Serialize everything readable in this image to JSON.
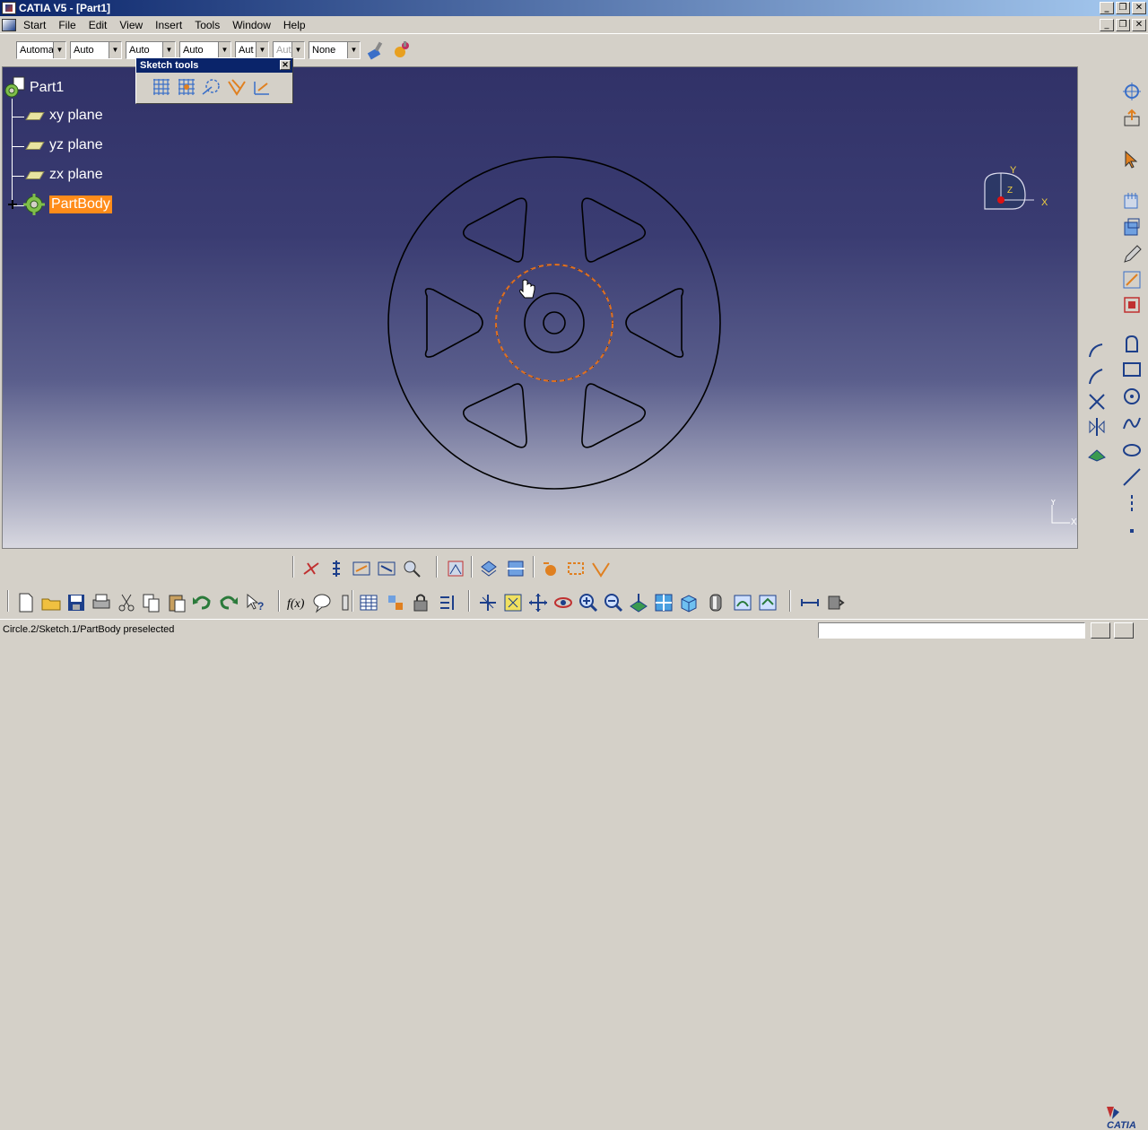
{
  "window": {
    "title": "CATIA V5 - [Part1]",
    "controls": [
      "_",
      "❐",
      "✕"
    ]
  },
  "menu": {
    "items": [
      "Start",
      "File",
      "Edit",
      "View",
      "Insert",
      "Tools",
      "Window",
      "Help"
    ]
  },
  "properties_toolbar": {
    "combos": [
      {
        "value": "Automa",
        "disabled": false
      },
      {
        "value": "Auto",
        "disabled": false
      },
      {
        "value": "Auto",
        "disabled": false
      },
      {
        "value": "Auto",
        "disabled": false
      },
      {
        "value": "Aut",
        "disabled": false
      },
      {
        "value": "Aut",
        "disabled": true
      },
      {
        "value": "None",
        "disabled": false
      }
    ]
  },
  "sketch_tools": {
    "title": "Sketch tools",
    "close": "✕"
  },
  "tree": {
    "root": "Part1",
    "items": [
      "xy plane",
      "yz plane",
      "zx plane"
    ],
    "partbody": "PartBody"
  },
  "compass": {
    "y_label": "Y",
    "x_label": "X",
    "z_label": "Z"
  },
  "axis_corner": {
    "y_label": "Y",
    "x_label": "X"
  },
  "logo": {
    "text": "CATIA"
  },
  "status": {
    "message": "Circle.2/Sketch.1/PartBody preselected",
    "command_value": ""
  },
  "colors": {
    "viewport_top": "#313268",
    "highlight": "#ff8c1a",
    "titlebar": "#0a246a"
  }
}
